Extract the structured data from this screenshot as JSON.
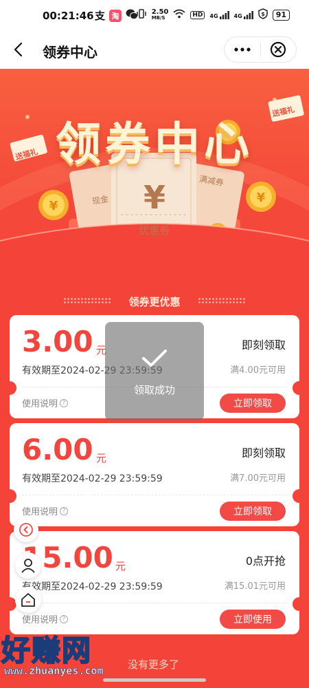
{
  "status_bar": {
    "time": "00:21:46",
    "net_speed_value": "2.50",
    "net_speed_unit": "MB/S",
    "hd_label": "HD",
    "signal_label_1": "4G",
    "signal_label_2": "4G",
    "battery": "91"
  },
  "nav": {
    "title": "领券中心"
  },
  "banner": {
    "title": "领券中心",
    "ticket_left": "现金",
    "ticket_center_symbol": "¥",
    "ticket_center_label": "优惠券",
    "ticket_right": "满减券",
    "tag_left": "送福礼",
    "tag_right": "送福礼"
  },
  "section": {
    "title": "领券更优惠"
  },
  "coupons": [
    {
      "amount": "3.00",
      "unit": "元",
      "expire": "有效期至2024-02-29 23:59:59",
      "state": "即刻领取",
      "condition": "满4.00元可用",
      "usage": "使用说明",
      "button": "立即领取"
    },
    {
      "amount": "6.00",
      "unit": "元",
      "expire": "有效期至2024-02-29 23:59:59",
      "state": "即刻领取",
      "condition": "满7.00元可用",
      "usage": "使用说明",
      "button": "立即领取"
    },
    {
      "amount": "15.00",
      "unit": "元",
      "expire": "有效期至2024-02-29 23:59:59",
      "state": "0点开抢",
      "condition": "满15.01元可用",
      "usage": "使用说明",
      "button": "立即使用"
    }
  ],
  "toast": {
    "message": "领取成功"
  },
  "footer": {
    "text": "没有更多了"
  },
  "watermark": {
    "big": "好赚网",
    "small": "www.zhuanyes.com"
  },
  "colors": {
    "accent": "#f4443a",
    "button": "#f24a47",
    "amount": "#f2453d"
  }
}
